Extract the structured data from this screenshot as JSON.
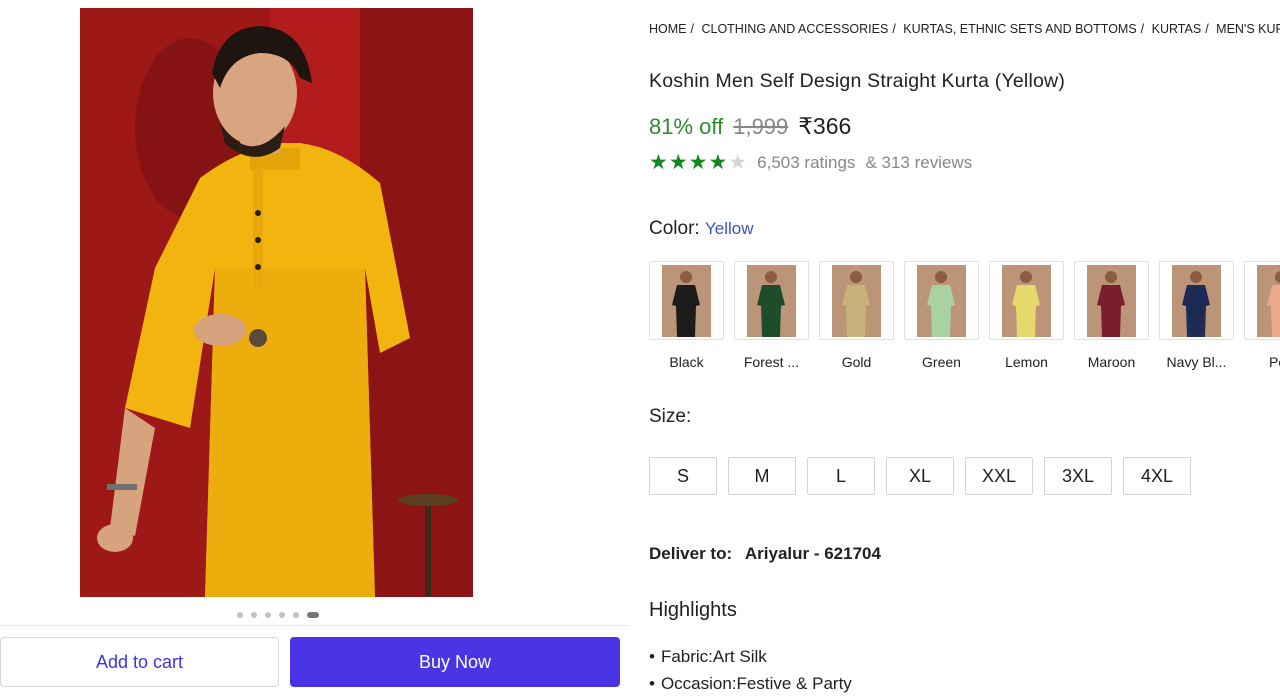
{
  "gallery": {
    "image_alt": "Man wearing yellow straight kurta",
    "dot_count": 6,
    "active_dot": 5
  },
  "actions": {
    "add_to_cart": "Add to cart",
    "buy_now": "Buy Now"
  },
  "breadcrumb": [
    "HOME",
    "CLOTHING AND ACCESSORIES",
    "KURTAS, ETHNIC SETS AND BOTTOMS",
    "KURTAS",
    "MEN'S KURTAS"
  ],
  "product": {
    "title": "Koshin Men Self Design Straight Kurta (Yellow)",
    "discount": "81% off",
    "mrp": "1,999",
    "price": "₹366",
    "rating": 4,
    "ratings_text": "6,503 ratings",
    "reviews_text": "& 313 reviews"
  },
  "color": {
    "label": "Color:",
    "selected": "Yellow",
    "options": [
      {
        "label": "Black",
        "hex": "#1c1c1c"
      },
      {
        "label": "Forest ...",
        "hex": "#1f4d2a"
      },
      {
        "label": "Gold",
        "hex": "#c9b27a"
      },
      {
        "label": "Green",
        "hex": "#a8d2a2"
      },
      {
        "label": "Lemon",
        "hex": "#e6d86a"
      },
      {
        "label": "Maroon",
        "hex": "#7a1d2c"
      },
      {
        "label": "Navy Bl...",
        "hex": "#1d2b55"
      },
      {
        "label": "Pea",
        "hex": "#e9a98a"
      }
    ]
  },
  "size": {
    "label": "Size:",
    "options": [
      "S",
      "M",
      "L",
      "XL",
      "XXL",
      "3XL",
      "4XL"
    ]
  },
  "delivery": {
    "label": "Deliver to:",
    "location": "Ariyalur - 621704"
  },
  "highlights": {
    "title": "Highlights",
    "items": [
      "Fabric:Art Silk",
      "Occasion:Festive & Party"
    ]
  },
  "colors": {
    "accent": "#4a34e6",
    "discount": "#2e8b2e",
    "star": "#13881f",
    "link": "#3b52c7"
  }
}
